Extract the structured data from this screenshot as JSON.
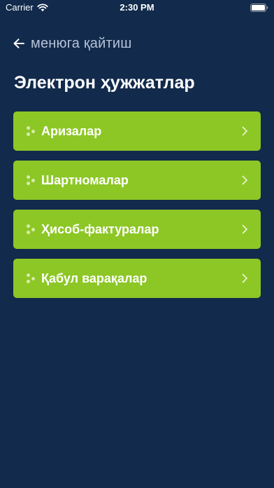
{
  "status_bar": {
    "carrier": "Carrier",
    "time": "2:30 PM"
  },
  "nav": {
    "back_label": "менюга қайтиш"
  },
  "page": {
    "title": "Электрон ҳужжатлар"
  },
  "menu": {
    "items": [
      {
        "label": "Аризалар"
      },
      {
        "label": "Шартномалар"
      },
      {
        "label": "Ҳисоб-фактуралар"
      },
      {
        "label": "Қабул варақалар"
      }
    ]
  },
  "colors": {
    "background": "#122a4b",
    "item_background": "#8dc726",
    "back_label": "#b6c3d6",
    "text": "#ffffff"
  },
  "icons": {
    "status": [
      "wifi-icon",
      "battery-icon"
    ],
    "nav": "back-arrow-icon",
    "item_left": "dots-icon",
    "item_right": "chevron-right-icon"
  }
}
